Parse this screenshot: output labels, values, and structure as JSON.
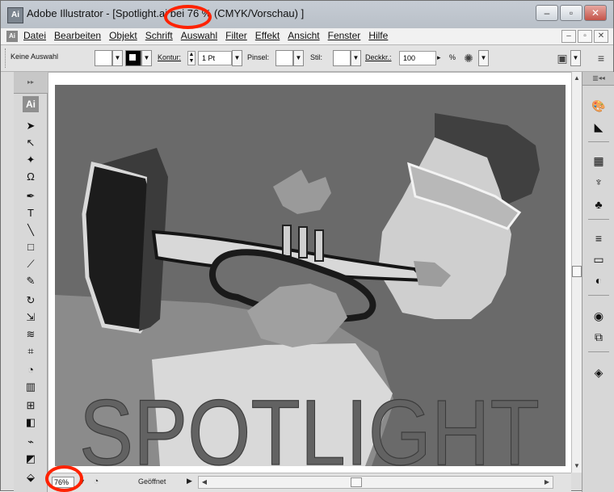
{
  "window": {
    "app_icon": "Ai",
    "title": "Adobe Illustrator - [Spotlight.ai bei 76 % (CMYK/Vorschau) ]",
    "controls": [
      "–",
      "▫",
      "✕"
    ]
  },
  "menu": {
    "app_icon": "Ai",
    "items": [
      "Datei",
      "Bearbeiten",
      "Objekt",
      "Schrift",
      "Auswahl",
      "Filter",
      "Effekt",
      "Ansicht",
      "Fenster",
      "Hilfe"
    ],
    "mdi_controls": [
      "–",
      "▫",
      "✕"
    ]
  },
  "control_bar": {
    "selection": "Keine Auswahl",
    "stroke_label": "Kontur:",
    "stroke_value": "1 Pt",
    "brush_label": "Pinsel:",
    "style_label": "Stil:",
    "opacity_label": "Deckkr.:",
    "opacity_value": "100",
    "opacity_unit": "%"
  },
  "tools": {
    "panel_logo": "Ai",
    "icons": [
      "selection-tool-icon",
      "direct-selection-tool-icon",
      "magic-wand-tool-icon",
      "lasso-tool-icon",
      "pen-tool-icon",
      "type-tool-icon",
      "line-tool-icon",
      "rectangle-tool-icon",
      "brush-tool-icon",
      "pencil-tool-icon",
      "rotate-tool-icon",
      "scale-tool-icon",
      "warp-tool-icon",
      "free-transform-tool-icon",
      "symbol-sprayer-tool-icon",
      "graph-tool-icon",
      "mesh-tool-icon",
      "gradient-tool-icon",
      "eyedropper-tool-icon",
      "blend-tool-icon",
      "live-paint-tool-icon"
    ]
  },
  "artwork": {
    "word": "SPOTLIGHT"
  },
  "status": {
    "zoom": "76%",
    "state": "Geöffnet"
  },
  "accent": {
    "highlight": "#ff2200"
  }
}
